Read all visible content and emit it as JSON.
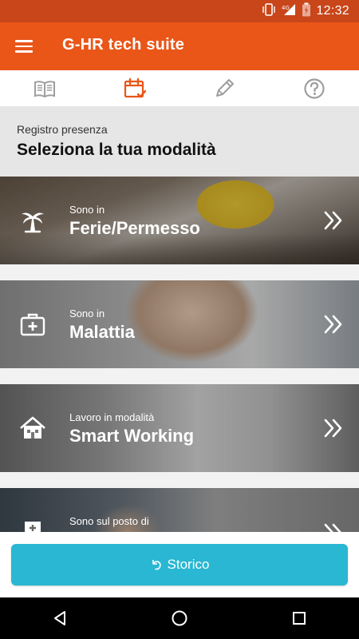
{
  "status_bar": {
    "time": "12:32",
    "network": "4G"
  },
  "app_bar": {
    "title": "G-HR tech suite",
    "menu_icon": "hamburger-menu-icon"
  },
  "tabs": [
    {
      "icon": "book-icon",
      "active": false
    },
    {
      "icon": "calendar-check-icon",
      "active": true
    },
    {
      "icon": "pencil-icon",
      "active": false
    },
    {
      "icon": "help-circle-icon",
      "active": false
    }
  ],
  "section": {
    "subtitle": "Registro presenza",
    "title": "Seleziona la tua modalità"
  },
  "cards": [
    {
      "small": "Sono in",
      "big": "Ferie/Permesso",
      "icon": "palm-tree-icon"
    },
    {
      "small": "Sono in",
      "big": "Malattia",
      "icon": "first-aid-kit-icon"
    },
    {
      "small": "Lavoro in modalità",
      "big": "Smart Working",
      "icon": "home-icon"
    },
    {
      "small": "Sono sul posto di",
      "big": "",
      "icon": "office-building-icon"
    }
  ],
  "storico": {
    "label": "Storico",
    "icon": "undo-icon"
  },
  "colors": {
    "primary": "#e95618",
    "status": "#c9461a",
    "accent": "#29b7d3"
  }
}
